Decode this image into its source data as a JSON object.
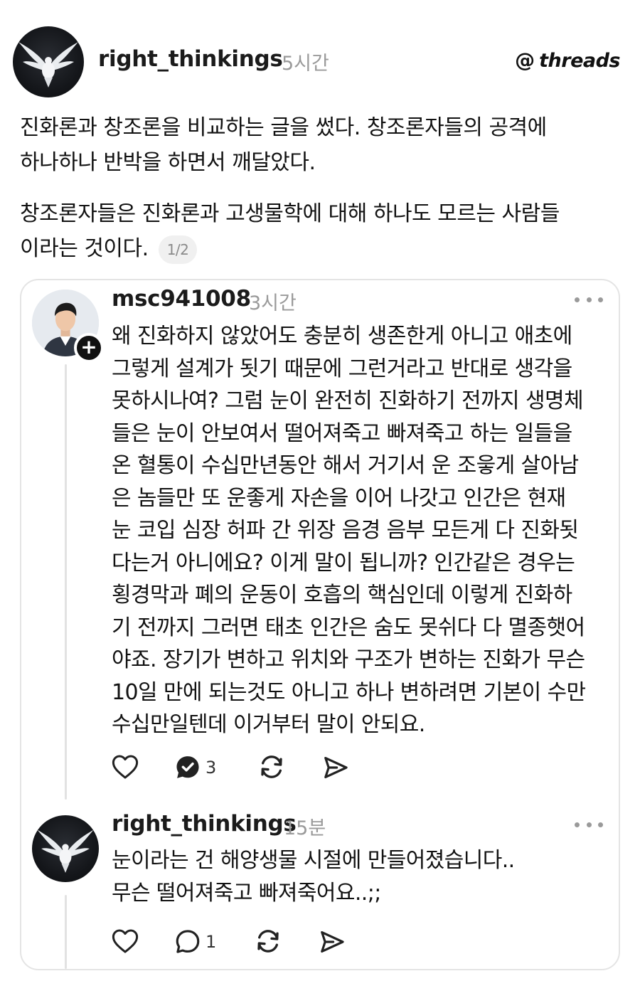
{
  "post": {
    "author": "right_thinkings",
    "time": "5시간",
    "brand": "threads",
    "paragraph1_line1": "진화론과 창조론을 비교하는 글을 썼다. 창조론자들의 공격에",
    "paragraph1_line2": "하나하나 반박을 하면서 깨달았다.",
    "paragraph2_line1": "창조론자들은 진화론과 고생물학에 대해 하나도 모르는 사람들",
    "paragraph2_line2": "이라는 것이다.",
    "page_indicator": "1/2"
  },
  "reply1": {
    "author": "msc941008",
    "time": "3시간",
    "lines": [
      "왜 진화하지 않았어도 충분히 생존한게 아니고 애초에",
      "그렇게 설계가 됫기 때문에 그런거라고 반대로 생각을",
      "못하시나여? 그럼 눈이 완전히 진화하기 전까지 생명체",
      "들은 눈이 안보여서 떨어져죽고 빠져죽고 하는 일들을",
      "온 혈통이 수십만년동안 해서 거기서 운 조읗게 살아남",
      "은 놈들만 또 운좋게 자손을 이어 나갓고 인간은 현재",
      "눈 코입 심장 허파 간 위장 음경 음부 모든게 다 진화됫",
      "다는거 아니에요? 이게 말이 됩니까? 인간같은 경우는",
      "횡경막과 폐의 운동이 호흡의 핵심인데 이렇게 진화하",
      "기 전까지 그러면 태초 인간은 숨도 못쉬다 다 멸종햇어",
      "야죠. 장기가 변하고 위치와 구조가 변하는 진화가 무슨",
      "10일 만에 되는것도 아니고 하나 변하려면 기본이 수만",
      "수십만일텐데 이거부터 말이 안되요."
    ],
    "reply_count": "3",
    "follow_symbol": "+"
  },
  "reply2": {
    "author": "right_thinkings",
    "time": "15분",
    "lines": [
      "눈이라는 건 해양생물 시절에 만들어졌습니다..",
      "무슨 떨어져죽고 빠져죽어요..;;"
    ],
    "reply_count": "1"
  },
  "icons": {
    "like": "heart-icon",
    "comment": "comment-icon",
    "repost": "repost-icon",
    "share": "send-icon",
    "more": "more-icon"
  },
  "colors": {
    "text": "#121212",
    "muted": "#9a9a9a",
    "border": "#e4e4e4"
  }
}
